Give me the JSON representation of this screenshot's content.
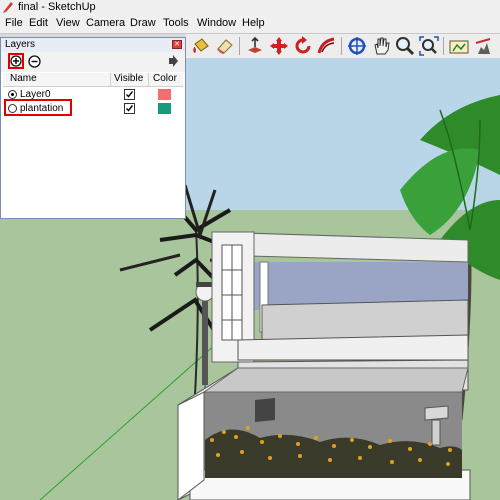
{
  "window": {
    "title": "final - SketchUp"
  },
  "menu": {
    "items": [
      "File",
      "Edit",
      "View",
      "Camera",
      "Draw",
      "Tools",
      "Window",
      "Help"
    ]
  },
  "toolbar": {
    "tools": [
      {
        "icon": "paint-bucket-icon"
      },
      {
        "icon": "eraser-icon"
      },
      {
        "icon": "push-pull-icon"
      },
      {
        "icon": "move-icon"
      },
      {
        "icon": "rotate-icon"
      },
      {
        "icon": "follow-me-icon"
      },
      {
        "icon": "orbit-icon"
      },
      {
        "icon": "pan-icon"
      },
      {
        "icon": "zoom-icon"
      },
      {
        "icon": "zoom-extents-icon"
      },
      {
        "icon": "position-camera-icon"
      },
      {
        "icon": "walk-icon"
      }
    ]
  },
  "layers_panel": {
    "title": "Layers",
    "columns": {
      "name": "Name",
      "visible": "Visible",
      "color": "Color"
    },
    "layers": [
      {
        "name": "Layer0",
        "active": true,
        "visible": true,
        "color": "#f07070"
      },
      {
        "name": "plantation",
        "active": false,
        "visible": true,
        "color": "#159a7a"
      }
    ]
  },
  "colors": {
    "sky": "#b8d6e8",
    "ground": "#a9c59b",
    "accent_red": "#e00000"
  }
}
